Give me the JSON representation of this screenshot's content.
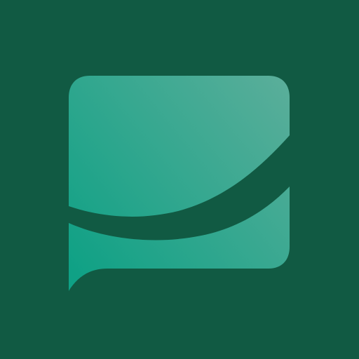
{
  "app_icon": {
    "name": "chat-bubble-logo",
    "background_color": "#115a43",
    "gradient_start_color": "#0fa185",
    "gradient_end_color": "#5aae9a"
  }
}
